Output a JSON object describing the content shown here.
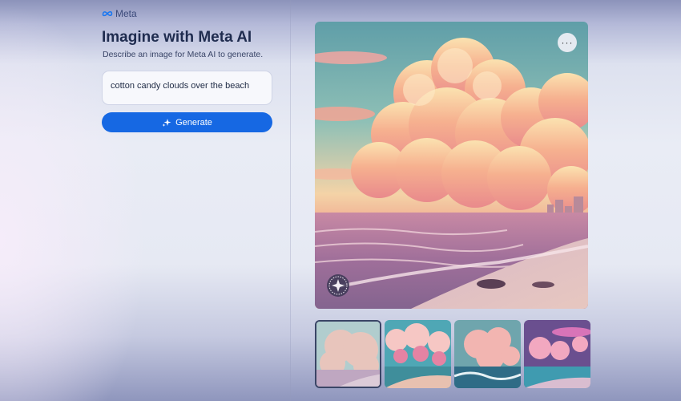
{
  "brand": {
    "name": "Meta",
    "logo_icon": "meta-infinity-icon",
    "logo_color": "#1877f2"
  },
  "header": {
    "title": "Imagine with Meta AI",
    "subtitle": "Describe an image for Meta AI to generate."
  },
  "prompt": {
    "value": "cotton candy clouds over the beach"
  },
  "generate_button": {
    "label": "Generate",
    "icon": "sparkle-icon",
    "color": "#1668e3"
  },
  "result": {
    "more_button": {
      "label": "···",
      "icon": "more-icon"
    },
    "watermark_icon": "imagined-with-ai-watermark-icon"
  },
  "thumbnails": [
    {
      "selected": true
    },
    {
      "selected": false
    },
    {
      "selected": false
    },
    {
      "selected": false
    }
  ]
}
